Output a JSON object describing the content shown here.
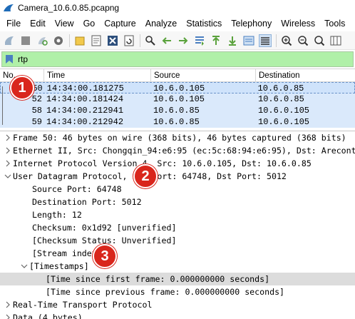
{
  "window": {
    "title": "Camera_10.6.0.85.pcapng"
  },
  "menu": [
    "File",
    "Edit",
    "View",
    "Go",
    "Capture",
    "Analyze",
    "Statistics",
    "Telephony",
    "Wireless",
    "Tools"
  ],
  "filter": {
    "value": "rtp"
  },
  "packet_list": {
    "columns": [
      "No.",
      "Time",
      "Source",
      "Destination"
    ],
    "rows": [
      {
        "no": "50",
        "time": "14:34:00.181275",
        "source": "10.6.0.105",
        "destination": "10.6.0.85"
      },
      {
        "no": "52",
        "time": "14:34:00.181424",
        "source": "10.6.0.105",
        "destination": "10.6.0.85"
      },
      {
        "no": "58",
        "time": "14:34:00.212941",
        "source": "10.6.0.85",
        "destination": "10.6.0.105"
      },
      {
        "no": "59",
        "time": "14:34:00.212942",
        "source": "10.6.0.85",
        "destination": "10.6.0.105"
      }
    ]
  },
  "details": [
    "Frame 50: 46 bytes on wire (368 bits), 46 bytes captured (368 bits)",
    "Ethernet II, Src: Chongqin_94:e6:95 (ec:5c:68:94:e6:95), Dst: Arecont",
    "Internet Protocol Version 4, Src: 10.6.0.105, Dst: 10.6.0.85",
    "User Datagram Protocol, Src Port: 64748, Dst Port: 5012",
    "Source Port: 64748",
    "Destination Port: 5012",
    "Length: 12",
    "Checksum: 0x1d92 [unverified]",
    "[Checksum Status: Unverified]",
    "[Stream index: 1]",
    "[Timestamps]",
    "[Time since first frame: 0.000000000 seconds]",
    "[Time since previous frame: 0.000000000 seconds]",
    "Real-Time Transport Protocol",
    "Data (4 bytes)"
  ],
  "badges": [
    "1",
    "2",
    "3"
  ],
  "colors": {
    "selected_row": "#cfe3fb",
    "row": "#dae9fb",
    "filter_bg": "#b0f0a8",
    "badge": "#d9261c"
  }
}
